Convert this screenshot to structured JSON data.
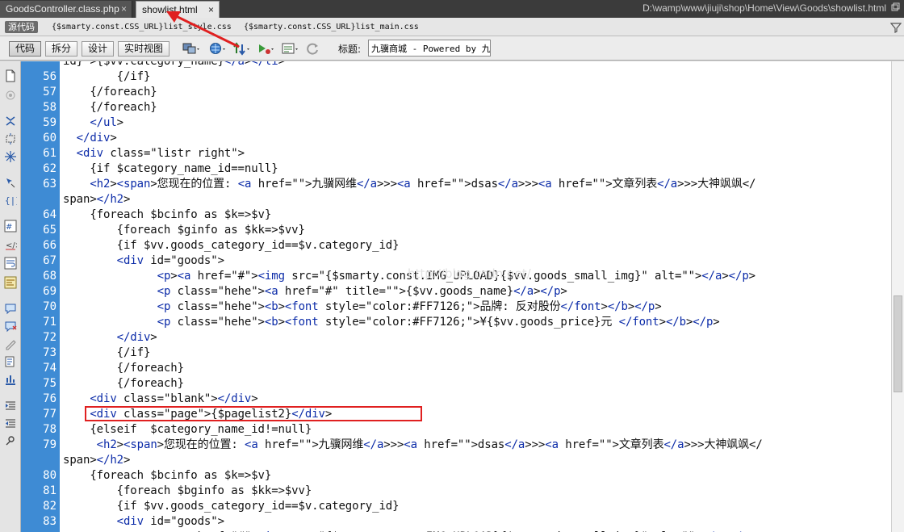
{
  "tabs": [
    {
      "label": "GoodsController.class.php",
      "close": "×"
    },
    {
      "label": "showlist.html",
      "close": "×"
    }
  ],
  "file_path": "D:\\wamp\\www\\jiuji\\shop\\Home\\View\\Goods\\showlist.html",
  "related_bar": {
    "source_label": "源代码",
    "files": [
      "{$smarty.const.CSS_URL}list_style.css",
      "{$smarty.const.CSS_URL}list_main.css"
    ]
  },
  "toolbar": {
    "views": [
      "代码",
      "拆分",
      "设计",
      "实时视图"
    ],
    "title_label": "标题:",
    "title_value": "九骥商城 - Powered by 九骥"
  },
  "watermark": "http://blog.csdn.net/",
  "code_lines": [
    {
      "n": "",
      "t": "id}\">{$vv.category_name}</a></li>"
    },
    {
      "n": "56",
      "t": "        {/if}"
    },
    {
      "n": "57",
      "t": "    {/foreach}"
    },
    {
      "n": "58",
      "t": "    {/foreach}"
    },
    {
      "n": "59",
      "t": "    </ul>"
    },
    {
      "n": "60",
      "t": "  </div>"
    },
    {
      "n": "61",
      "t": "  <div class=\"listr right\">"
    },
    {
      "n": "62",
      "t": "    {if $category_name_id==null}"
    },
    {
      "n": "63",
      "t": "    <h2><span>您现在的位置: <a href=\"\">九骥网维</a>>><a href=\"\">dsas</a>>><a href=\"\">文章列表</a>>>大神飒飒</"
    },
    {
      "n": "",
      "t": "span></h2>"
    },
    {
      "n": "64",
      "t": "    {foreach $bcinfo as $k=>$v}"
    },
    {
      "n": "65",
      "t": "        {foreach $ginfo as $kk=>$vv}"
    },
    {
      "n": "66",
      "t": "        {if $vv.goods_category_id==$v.category_id}"
    },
    {
      "n": "67",
      "t": "        <div id=\"goods\">"
    },
    {
      "n": "68",
      "t": "              <p><a href=\"#\"><img src=\"{$smarty.const.IMG_UPLOAD}{$vv.goods_small_img}\" alt=\"\"></a></p>"
    },
    {
      "n": "69",
      "t": "              <p class=\"hehe\"><a href=\"#\" title=\"\">{$vv.goods_name}</a></p>"
    },
    {
      "n": "70",
      "t": "              <p class=\"hehe\"><b><font style=\"color:#FF7126;\">品牌: 反对股份</font></b></p>"
    },
    {
      "n": "71",
      "t": "              <p class=\"hehe\"><b><font style=\"color:#FF7126;\">¥{$vv.goods_price}元 </font></b></p>"
    },
    {
      "n": "72",
      "t": "        </div>"
    },
    {
      "n": "73",
      "t": "        {/if}"
    },
    {
      "n": "74",
      "t": "        {/foreach}"
    },
    {
      "n": "75",
      "t": "        {/foreach}"
    },
    {
      "n": "76",
      "t": "    <div class=\"blank\"></div>"
    },
    {
      "n": "77",
      "t": "    <div class=\"page\">{$pagelist2}</div>"
    },
    {
      "n": "78",
      "t": "    {elseif  $category_name_id!=null}"
    },
    {
      "n": "79",
      "t": "     <h2><span>您现在的位置: <a href=\"\">九骥网维</a>>><a href=\"\">dsas</a>>><a href=\"\">文章列表</a>>>大神飒飒</"
    },
    {
      "n": "",
      "t": "span></h2>"
    },
    {
      "n": "80",
      "t": "    {foreach $bcinfo as $k=>$v}"
    },
    {
      "n": "81",
      "t": "        {foreach $bginfo as $kk=>$vv}"
    },
    {
      "n": "82",
      "t": "        {if $vv.goods_category_id==$v.category_id}"
    },
    {
      "n": "83",
      "t": "        <div id=\"goods\">"
    },
    {
      "n": "",
      "t": "              <p><a href=\"#\"><img src=\"{$smarty.const.IMG_UPLOAD}{$vv.goods_small_img}\" alt=\"\"></a></p>"
    }
  ],
  "highlighted_line": "77",
  "colors": {
    "gutter": "#3e8bd4",
    "highlight_box": "#e02020",
    "arrow": "#e02020",
    "tab_bar": "#3b3b3b"
  }
}
